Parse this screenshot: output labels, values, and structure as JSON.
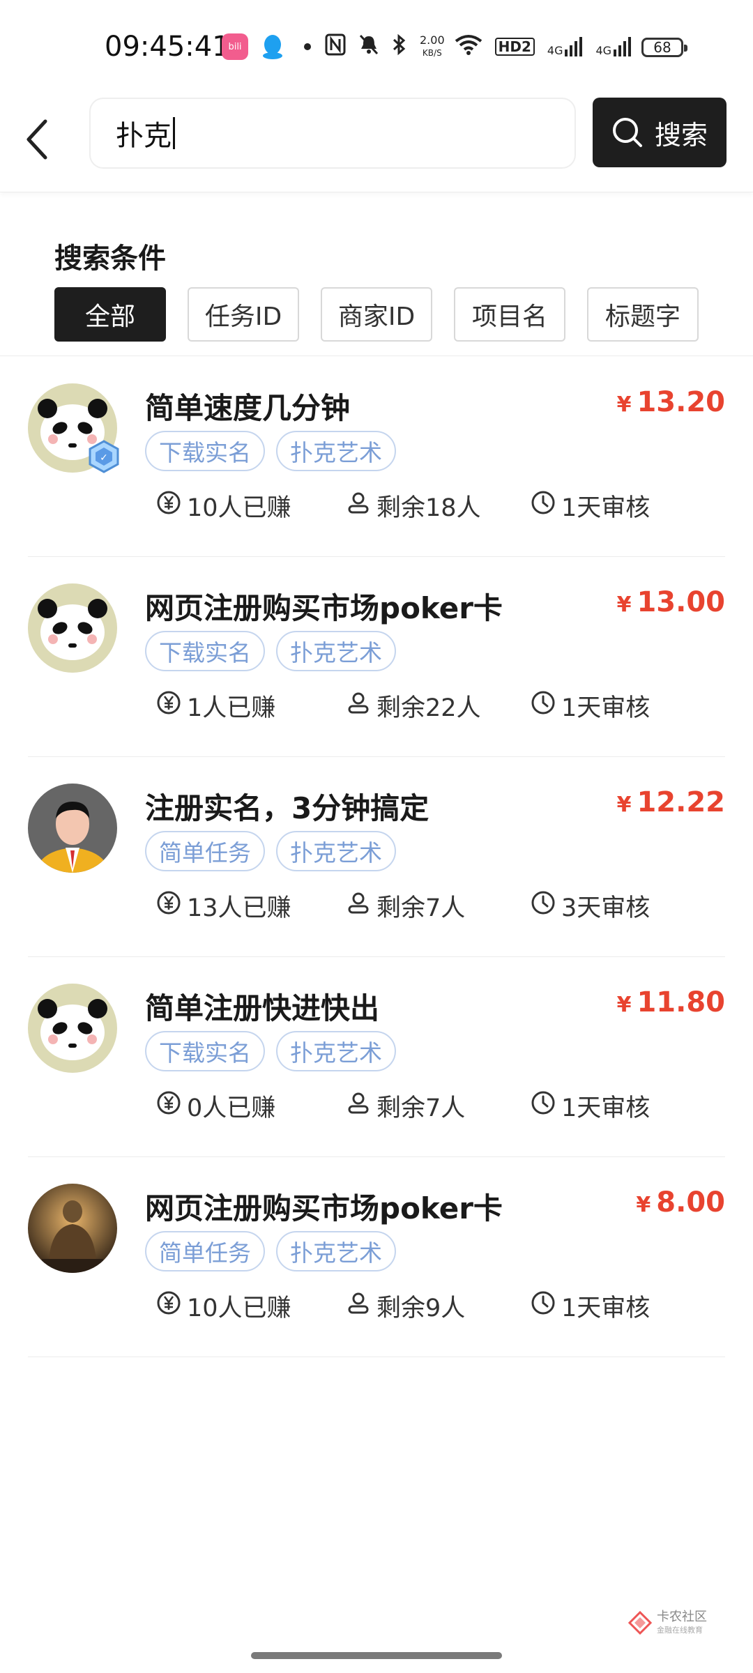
{
  "status_bar": {
    "time": "09:45:41",
    "net_speed_value": "2.00",
    "net_speed_unit": "KB/S",
    "hd_label": "HD2",
    "signal1": "4G",
    "signal2": "4G",
    "battery": "68",
    "icons": [
      "bilibili-app-icon",
      "qq-app-icon",
      "dot-icon",
      "nfc-icon",
      "mute-icon",
      "bluetooth-icon",
      "wifi-icon",
      "hd-icon",
      "signal-icon",
      "signal-icon",
      "battery-icon"
    ]
  },
  "header": {
    "search_value": "扑克",
    "search_button_label": "搜索"
  },
  "filters": {
    "title": "搜索条件",
    "options": [
      "全部",
      "任务ID",
      "商家ID",
      "项目名",
      "标题字"
    ],
    "active_index": 0
  },
  "tasks": [
    {
      "title": "简单速度几分钟",
      "price": "13.20",
      "tags": [
        "下载实名",
        "扑克艺术"
      ],
      "earned": "10人已赚",
      "remaining": "剩余18人",
      "review": "1天审核",
      "avatar": "panda",
      "verified": true
    },
    {
      "title": "网页注册购买市场poker卡",
      "price": "13.00",
      "tags": [
        "下载实名",
        "扑克艺术"
      ],
      "earned": "1人已赚",
      "remaining": "剩余22人",
      "review": "1天审核",
      "avatar": "panda",
      "verified": false
    },
    {
      "title": "注册实名，3分钟搞定",
      "price": "12.22",
      "tags": [
        "简单任务",
        "扑克艺术"
      ],
      "earned": "13人已赚",
      "remaining": "剩余7人",
      "review": "3天审核",
      "avatar": "person",
      "verified": false
    },
    {
      "title": "简单注册快进快出",
      "price": "11.80",
      "tags": [
        "下载实名",
        "扑克艺术"
      ],
      "earned": "0人已赚",
      "remaining": "剩余7人",
      "review": "1天审核",
      "avatar": "panda",
      "verified": false
    },
    {
      "title": "网页注册购买市场poker卡",
      "price": "8.00",
      "tags": [
        "简单任务",
        "扑克艺术"
      ],
      "earned": "10人已赚",
      "remaining": "剩余9人",
      "review": "1天审核",
      "avatar": "statue",
      "verified": false
    }
  ],
  "currency_symbol": "¥",
  "watermark": {
    "text": "卡农社区",
    "subtext": "金融在线教育"
  },
  "colors": {
    "price": "#e8432f",
    "tag_text": "#7b9ed6",
    "tag_border": "#c5d5ee",
    "active_chip": "#1e1e1e"
  }
}
